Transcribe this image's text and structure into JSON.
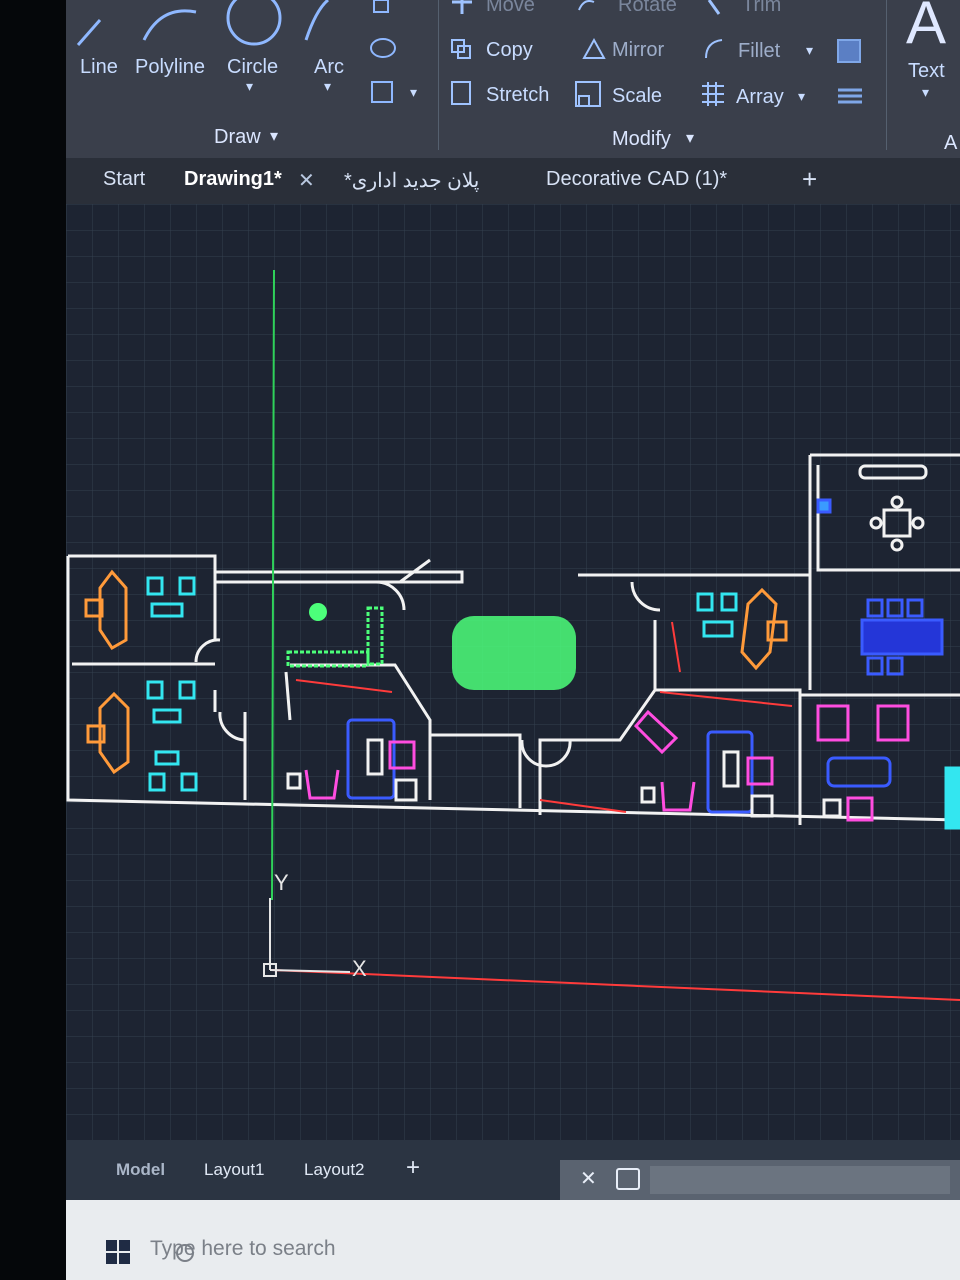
{
  "ribbon": {
    "draw_tools": [
      "Line",
      "Polyline",
      "Circle",
      "Arc"
    ],
    "modify_tools": {
      "move": "Move",
      "rotate": "Rotate",
      "trim": "Trim",
      "copy": "Copy",
      "mirror": "Mirror",
      "fillet": "Fillet",
      "stretch": "Stretch",
      "scale": "Scale",
      "array": "Array"
    },
    "text_tool": "Text",
    "text_glyph": "A",
    "panels": {
      "draw": "Draw",
      "modify": "Modify",
      "annotation_cut": "A"
    },
    "dropdown_glyph": "▾"
  },
  "tabs": {
    "start": "Start",
    "drawing1": "Drawing1*",
    "close_glyph": "✕",
    "persian_plan": "*پلان جدید اداری",
    "decorative": "Decorative CAD (1)*",
    "add_glyph": "+"
  },
  "canvas": {
    "ucs_y": "Y",
    "ucs_x": "X",
    "colors": {
      "background": "#1d2432",
      "grid": "#34404f",
      "walls": "#f2f2f2",
      "green": "#4cff7a",
      "cyan": "#33e6f0",
      "orange": "#ff9a3a",
      "blue": "#3a5bff",
      "magenta": "#ff4de0",
      "red": "#ff3b3b"
    }
  },
  "layout_tabs": {
    "model": "Model",
    "layout1": "Layout1",
    "layout2": "Layout2",
    "add_glyph": "+"
  },
  "command_line": {
    "close_glyph": "✕"
  },
  "taskbar": {
    "search_placeholder": "Type here to search"
  }
}
